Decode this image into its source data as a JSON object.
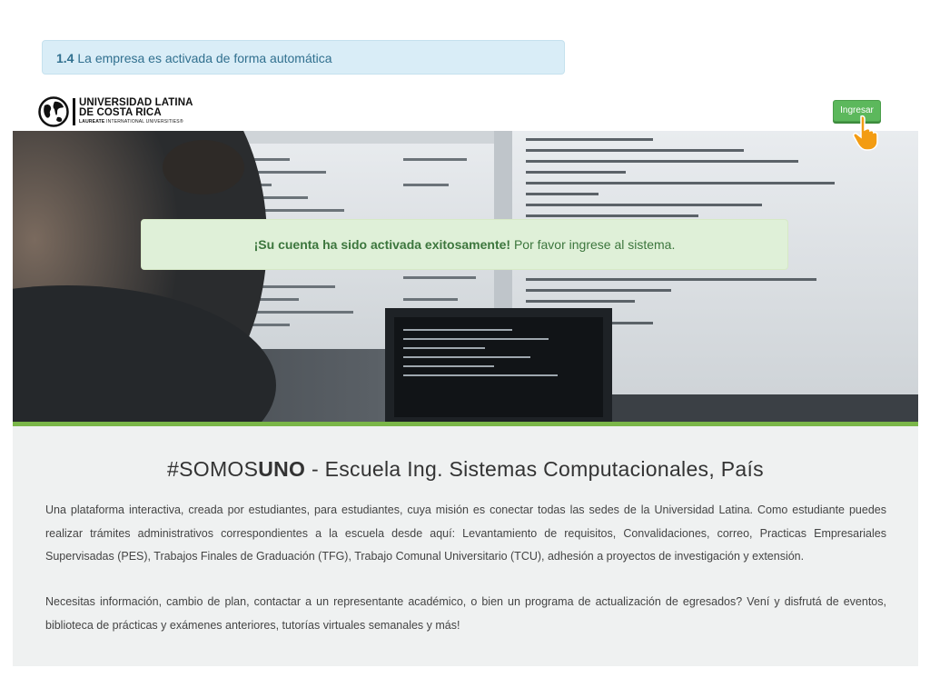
{
  "step_alert": {
    "number": "1.4",
    "text": "La empresa es activada de forma automática"
  },
  "logo": {
    "line1": "UNIVERSIDAD LATINA",
    "line2": "DE COSTA RICA",
    "line3_bold": "LAUREATE",
    "line3_rest": "INTERNATIONAL UNIVERSITIES®"
  },
  "nav": {
    "login_label": "Ingresar"
  },
  "hero": {
    "alert_bold": "¡Su cuenta ha sido activada exitosamente!",
    "alert_rest": "Por favor ingrese al sistema."
  },
  "about": {
    "title_prefix": "#SOMOS",
    "title_bold": "UNO",
    "title_rest": "- Escuela Ing. Sistemas Computacionales, País",
    "paragraph1": "Una plataforma interactiva, creada por estudiantes, para estudiantes, cuya misión es conectar todas las sedes de la Universidad Latina. Como estudiante puedes realizar trámites administrativos correspondientes a la escuela desde aquí: Levantamiento de requisitos, Convalidaciones, correo, Practicas Empresariales Supervisadas (PES), Trabajos Finales de Graduación (TFG), Trabajo Comunal Universitario (TCU), adhesión a proyectos de investigación y extensión.",
    "paragraph2": "Necesitas información, cambio de plan, contactar a un representante académico, o bien un programa de actualización de egresados? Vení y disfrutá de eventos, biblioteca de prácticas y exámenes anteriores, tutorías virtuales semanales y más!"
  },
  "colors": {
    "accent_green": "#7ab648",
    "button_green": "#5cb85c",
    "info_bg": "#d9edf7",
    "success_bg": "#dff0d8"
  },
  "icons": [
    "globe-logo-icon",
    "hand-pointer-icon"
  ]
}
